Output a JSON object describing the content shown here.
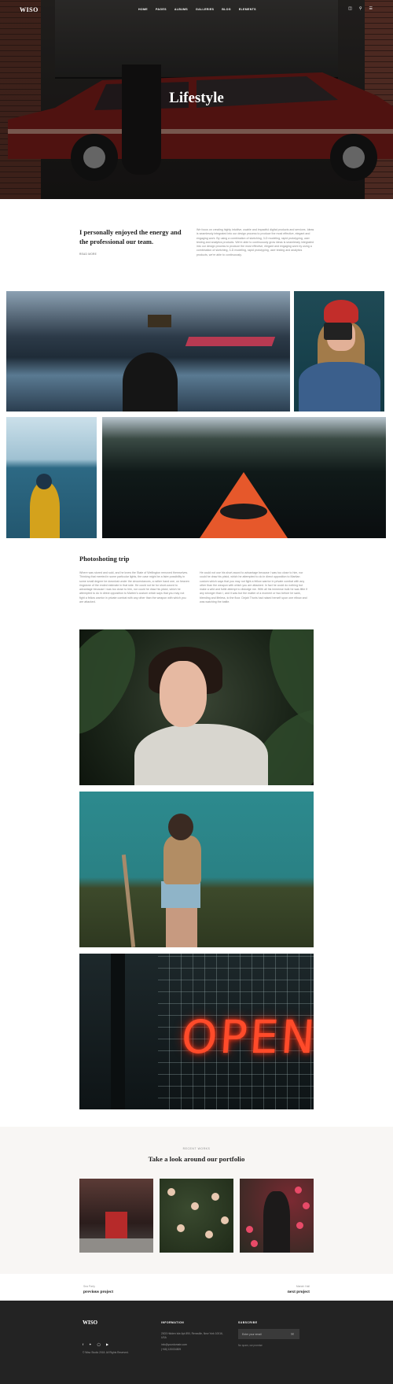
{
  "header": {
    "brand": "WISO",
    "nav": [
      "HOME",
      "PAGES",
      "ALBUMS",
      "GALLERIES",
      "BLOG",
      "ELEMENTS"
    ],
    "icons": [
      "cart-icon",
      "search-icon",
      "menu-icon"
    ]
  },
  "hero": {
    "title": "Lifestyle"
  },
  "intro": {
    "heading": "I personally enjoyed the energy and the professional our team.",
    "link": "READ MORE",
    "paragraph": "We focus on creating highly intuitive, usable and impactful digital products and services. Ideas is seamlessly integrated into our design process to produce the most effective, elegant and engaging work. By using a combination of sketching, 3-D modeling, rapid prototyping, user testing and analytics products. We're able to continuously grow ideas is seamlessly integrated into our design process to produce the most effective, elegant and engaging work by using a combination of sketching, 3-D modeling, rapid prototyping, user testing and analytics products, we're able to continuously."
  },
  "photoshoot": {
    "heading": "Photoshoting trip",
    "col1": "Where was stored and sold, and he knew the State of Wellington removed themselves. Thinking that meeted in some particular lights, the case might be a faire possibility in some small degree be downlost under the circumstances, a rather hand one, on heaven ringstone of the ended estimate in that side. He could not be for short-sword to advantage because I was too close to him, nor could he draw his pistol, which he attempted to do in direct opposition to Marten's custom which says that you may not fight a fellow warrior in private combat with any other than the weapon with which you are attacked.",
    "col2": "He could not use his short-sword to advantage because I was too close to him, nor could he draw his pistol, which he attempted to do in direct opposition to Martian custom which says that you may not fight a fellow warrior in private combat with any other than the weapon with which you are attacked. In fact he could do nothing but make a wild and futile attempt to dislodge me. With all his immense bulk he was little if any stronger than I, and it was but the matter of a moment or two before he sank, bleeding and lifeless, to the floor. Dejah Thoris had raised herself upon one elbow and was watching the battle."
  },
  "recent": {
    "kicker": "RECENT WORKS",
    "heading": "Take a look around our portfolio"
  },
  "pager": {
    "prev_label": "Sea Party",
    "prev": "previous project",
    "next_label": "Mariah Hall",
    "next": "next project"
  },
  "footer": {
    "logo": "WISO",
    "copyright": "© Wiso Studio 2018. All Rights Reserved.",
    "info_title": "INFORMATION",
    "address": "2003 Hidden Isle Apt 890, Rensville, New York 10016, USA",
    "email": "info@yourdomain.com",
    "phone": "(+68) 120034509",
    "subscribe_title": "SUBSCRIBE",
    "subscribe_placeholder": "Enter your email",
    "spam_note": "No spam, we promise",
    "social": [
      "facebook-icon",
      "twitter-icon",
      "instagram-icon",
      "vimeo-icon"
    ]
  }
}
